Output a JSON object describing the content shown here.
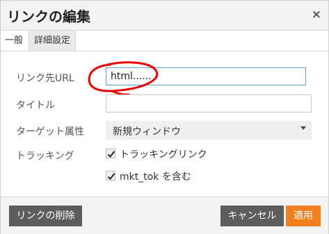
{
  "dialog": {
    "title": "リンクの編集",
    "close_symbol": "×"
  },
  "tabs": [
    {
      "label": "一般"
    },
    {
      "label": "詳細設定"
    }
  ],
  "form": {
    "url_label": "リンク先URL",
    "url_value": "html......",
    "title_label": "タイトル",
    "title_value": "",
    "target_label": "ターゲット属性",
    "target_value": "新規ウィンドウ",
    "tracking_label": "トラッキング",
    "tracking_link_label": "トラッキングリンク",
    "tracking_link_checked": true,
    "mkt_tok_label": "mkt_tok を含む",
    "mkt_tok_checked": true
  },
  "footer": {
    "delete_label": "リンクの削除",
    "cancel_label": "キャンセル",
    "apply_label": "適用"
  },
  "colors": {
    "apply_button": "#f07f1f",
    "dark_button": "#5d5d5d",
    "annotation": "#e60000",
    "input_focus": "#5aa0d6"
  }
}
